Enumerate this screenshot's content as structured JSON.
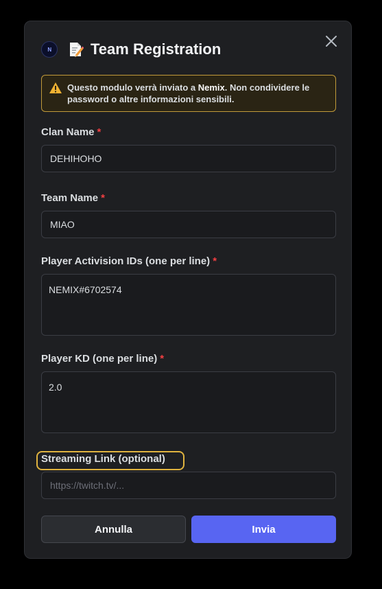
{
  "modal": {
    "title": "Team Registration",
    "avatar_text": "N"
  },
  "warning": {
    "text_before": "Questo modulo verrà inviato a ",
    "brand": "Nemix",
    "text_after": ". Non condividere le password o altre informazioni sensibili."
  },
  "fields": {
    "clan_name": {
      "label": "Clan Name",
      "required_mark": "*",
      "value": "DEHIHOHO"
    },
    "team_name": {
      "label": "Team Name",
      "required_mark": "*",
      "value": "MIAO"
    },
    "player_ids": {
      "label": "Player Activision IDs (one per line)",
      "required_mark": "*",
      "value": "NEMIX#6702574"
    },
    "player_kd": {
      "label": "Player KD (one per line)",
      "required_mark": "*",
      "value": "2.0"
    },
    "streaming_link": {
      "label": "Streaming Link (optional)",
      "placeholder": "https://twitch.tv/..."
    }
  },
  "buttons": {
    "cancel": "Annulla",
    "submit": "Invia"
  },
  "colors": {
    "accent": "#5865f2",
    "warning_border": "#c29b3a",
    "required": "#f23f42",
    "focus_ring": "#e0b33f"
  }
}
